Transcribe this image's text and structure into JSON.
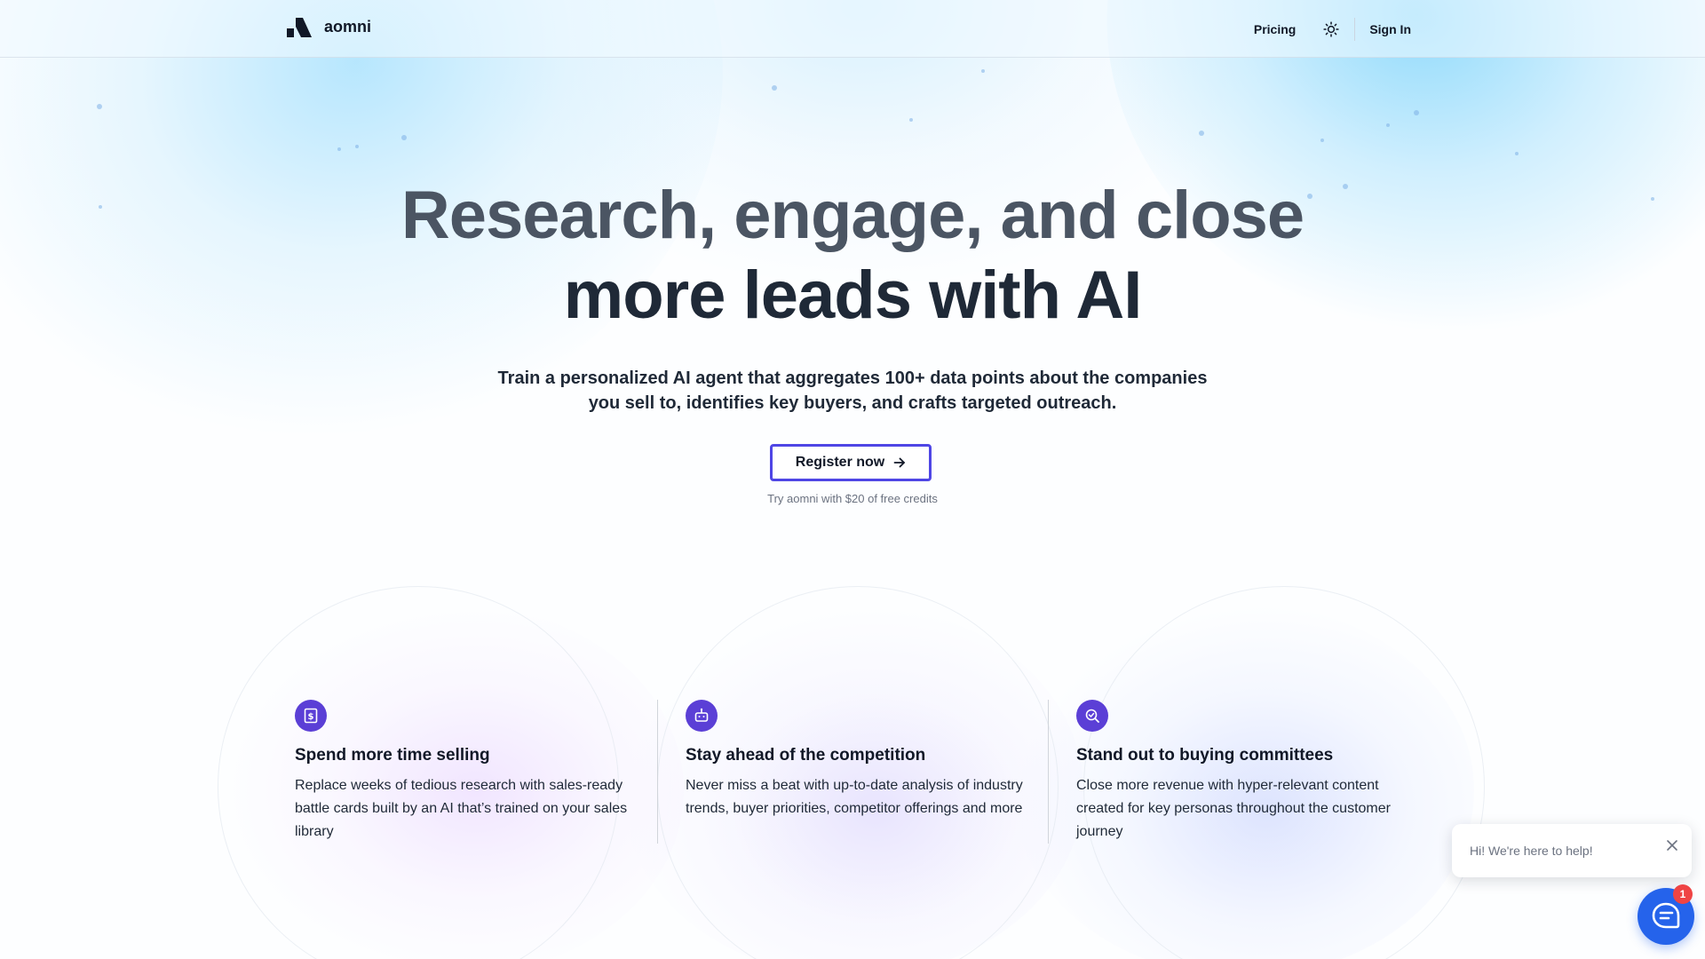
{
  "header": {
    "brand": "aomni",
    "nav": {
      "pricing": "Pricing",
      "sign_in": "Sign In"
    },
    "icons": {
      "logo": "aomni-logo-icon",
      "theme": "sun-icon"
    }
  },
  "hero": {
    "title_line1": "Research, engage, and close",
    "title_line2": "more leads with AI",
    "subtitle": "Train a personalized AI agent that aggregates 100+ data points about the companies you sell to, identifies key buyers, and crafts targeted outreach.",
    "cta_label": "Register now",
    "cta_icon": "arrow-right-icon",
    "note": "Try aomni with $20 of free credits"
  },
  "features": [
    {
      "icon": "dollar-document-icon",
      "title": "Spend more time selling",
      "description": "Replace weeks of tedious research with sales-ready battle cards built by an AI that’s trained on your sales library"
    },
    {
      "icon": "robot-icon",
      "title": "Stay ahead of the competition",
      "description": "Never miss a beat with up-to-date analysis of industry trends, buyer priorities, competitor offerings and more"
    },
    {
      "icon": "search-check-icon",
      "title": "Stand out to buying committees",
      "description": "Close more revenue with hyper-relevant content created for key personas throughout the customer journey"
    }
  ],
  "chat": {
    "greeting": "Hi! We're here to help!",
    "badge_count": "1",
    "close_icon": "close-icon",
    "launcher_icon": "chat-icon"
  },
  "colors": {
    "accent": "#4f46e5",
    "feature_icon_bg": "#5b3fd6",
    "chat_blue": "#2563eb",
    "badge_red": "#ef4444"
  }
}
